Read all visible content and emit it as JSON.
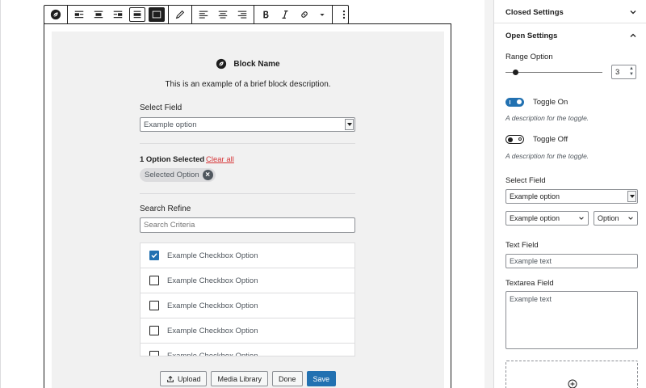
{
  "toolbar": {
    "icons": [
      "leaf-icon",
      "align-left-icon",
      "align-center-icon",
      "align-right-icon",
      "align-wide-icon",
      "align-full-icon",
      "pencil-icon",
      "text-align-left-icon",
      "text-align-center-icon",
      "text-align-right-icon",
      "bold-icon",
      "italic-icon",
      "link-icon",
      "chevron-down-icon",
      "more-options-icon"
    ],
    "active_item": "align-full-icon"
  },
  "block": {
    "title": "Block Name",
    "description": "This is an example of a brief block description.",
    "select_field": {
      "label": "Select Field",
      "value": "Example option"
    },
    "selected_summary": "1 Option Selected",
    "clear_all": "Clear all",
    "chip": "Selected Option",
    "search": {
      "label": "Search Refine",
      "placeholder": "Search Criteria"
    },
    "checkbox_options": [
      {
        "label": "Example Checkbox Option",
        "checked": true
      },
      {
        "label": "Example Checkbox Option",
        "checked": false
      },
      {
        "label": "Example Checkbox Option",
        "checked": false
      },
      {
        "label": "Example Checkbox Option",
        "checked": false
      },
      {
        "label": "Example Checkbox Option",
        "checked": false
      }
    ],
    "buttons": {
      "upload": "Upload",
      "media_library": "Media Library",
      "done": "Done",
      "save": "Save"
    }
  },
  "sidebar": {
    "closed_panel": "Closed Settings",
    "open_panel": "Open Settings",
    "range": {
      "label": "Range Option",
      "value": "3",
      "fraction": 0.1
    },
    "toggle_on": {
      "label": "Toggle On",
      "help": "A description for the toggle.",
      "state": "on"
    },
    "toggle_off": {
      "label": "Toggle Off",
      "help": "A description for the toggle.",
      "state": "off"
    },
    "select_field": {
      "label": "Select Field",
      "value": "Example option",
      "second_value": "Example option",
      "third_value": "Option"
    },
    "text_field": {
      "label": "Text Field",
      "value": "Example text"
    },
    "textarea_field": {
      "label": "Textarea Field",
      "value": "Example text"
    }
  },
  "colors": {
    "accent": "#2271b1",
    "danger": "#d63638",
    "block_bg": "#f1f1f1"
  }
}
